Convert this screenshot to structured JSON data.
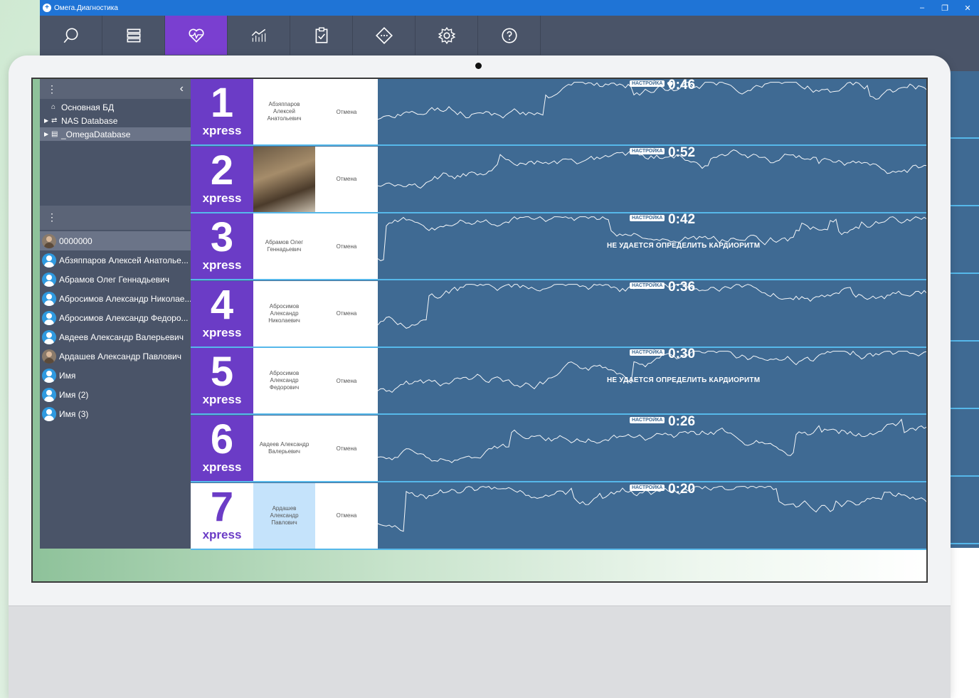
{
  "window": {
    "title": "Омега.Диагностика",
    "controls": [
      "–",
      "❐",
      "✕"
    ]
  },
  "toolbar": {
    "active_index": 2,
    "tools": [
      {
        "icon": "search-icon"
      },
      {
        "icon": "list-icon"
      },
      {
        "icon": "heart-pulse-icon"
      },
      {
        "icon": "chart-icon"
      },
      {
        "icon": "clipboard-check-icon"
      },
      {
        "icon": "diamond-icon"
      },
      {
        "icon": "gear-icon"
      },
      {
        "icon": "help-icon"
      }
    ]
  },
  "sidebar": {
    "databases": [
      {
        "label": "Основная БД",
        "icon": "home-icon",
        "expandable": false,
        "selected": false
      },
      {
        "label": "NAS Database",
        "icon": "network-icon",
        "expandable": true,
        "selected": false
      },
      {
        "label": "_OmegaDatabase",
        "icon": "file-icon",
        "expandable": true,
        "selected": true
      }
    ],
    "patients": [
      {
        "label": "0000000",
        "avatar": "photo",
        "selected": true
      },
      {
        "label": "Абзяппаров Алексей Анатолье...",
        "avatar": "default",
        "selected": false
      },
      {
        "label": "Абрамов Олег Геннадьевич",
        "avatar": "default",
        "selected": false
      },
      {
        "label": "Абросимов Александр Николае...",
        "avatar": "default",
        "selected": false
      },
      {
        "label": "Абросимов Александр Федоро...",
        "avatar": "default",
        "selected": false
      },
      {
        "label": "Авдеев Александр Валерьевич",
        "avatar": "default",
        "selected": false
      },
      {
        "label": "Ардашев Александр Павлович",
        "avatar": "photo",
        "selected": false
      },
      {
        "label": "Имя",
        "avatar": "default",
        "selected": false
      },
      {
        "label": "Имя (2)",
        "avatar": "default",
        "selected": false
      },
      {
        "label": "Имя (3)",
        "avatar": "default",
        "selected": false
      }
    ]
  },
  "channels": [
    {
      "number": "1",
      "brand": "xpress",
      "patient": "Абзяппаров Алексей Анатольевич",
      "cancel": "Отмена",
      "badge": "НАСТРОЙКА",
      "timer": "0:46",
      "message": "",
      "heart": true
    },
    {
      "number": "2",
      "brand": "xpress",
      "patient": "",
      "photo": true,
      "cancel": "Отмена",
      "badge": "НАСТРОЙКА",
      "timer": "0:52",
      "message": ""
    },
    {
      "number": "3",
      "brand": "xpress",
      "patient": "Абрамов Олег Геннадьевич",
      "cancel": "Отмена",
      "badge": "НАСТРОЙКА",
      "timer": "0:42",
      "message": "НЕ УДАЕТСЯ ОПРЕДЕЛИТЬ КАРДИОРИТМ"
    },
    {
      "number": "4",
      "brand": "xpress",
      "patient": "Абросимов Александр Николаевич",
      "cancel": "Отмена",
      "badge": "НАСТРОЙКА",
      "timer": "0:36",
      "message": ""
    },
    {
      "number": "5",
      "brand": "xpress",
      "patient": "Абросимов Александр Федорович",
      "cancel": "Отмена",
      "badge": "НАСТРОЙКА",
      "timer": "0:30",
      "message": "НЕ УДАЕТСЯ ОПРЕДЕЛИТЬ КАРДИОРИТМ"
    },
    {
      "number": "6",
      "brand": "xpress",
      "patient": "Авдеев Александр Валерьевич",
      "cancel": "Отмена",
      "badge": "НАСТРОЙКА",
      "timer": "0:26",
      "message": ""
    },
    {
      "number": "7",
      "brand": "xpress",
      "patient": "Ардашев Александр Павлович",
      "highlighted": true,
      "white": true,
      "cancel": "Отмена",
      "badge": "НАСТРОЙКА",
      "timer": "0:20",
      "message": ""
    }
  ],
  "colors": {
    "accent": "#6b3cc6",
    "toolbar_active": "#7a3fd0",
    "titlebar": "#1f74d6",
    "sidebar": "#4a5468",
    "monitor_bg": "#3f6a93",
    "row_divider": "#56b8ea"
  }
}
